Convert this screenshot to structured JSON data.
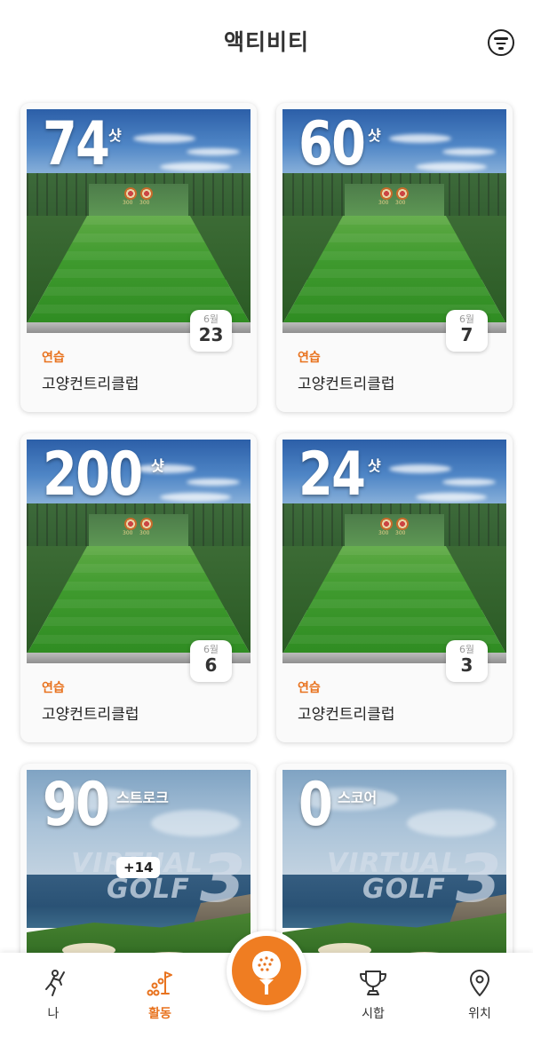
{
  "header": {
    "title": "액티비티"
  },
  "activities": [
    {
      "type": "practice",
      "value": "74",
      "unit": "샷",
      "type_label": "연습",
      "venue": "고양컨트리클럽",
      "month": "6월",
      "day": "23"
    },
    {
      "type": "practice",
      "value": "60",
      "unit": "샷",
      "type_label": "연습",
      "venue": "고양컨트리클럽",
      "month": "6월",
      "day": "7"
    },
    {
      "type": "practice",
      "value": "200",
      "unit": "샷",
      "type_label": "연습",
      "venue": "고양컨트리클럽",
      "month": "6월",
      "day": "6"
    },
    {
      "type": "practice",
      "value": "24",
      "unit": "샷",
      "type_label": "연습",
      "venue": "고양컨트리클럽",
      "month": "6월",
      "day": "3"
    },
    {
      "type": "round",
      "value": "90",
      "unit": "스트로크",
      "diff": "+14",
      "logo_l1": "VIRTUAL",
      "logo_l2": "GOLF",
      "logo_num": "3"
    },
    {
      "type": "round",
      "value": "0",
      "unit": "스코어",
      "logo_l1": "VIRTUAL",
      "logo_l2": "GOLF",
      "logo_num": "3"
    }
  ],
  "nav": {
    "items": [
      {
        "label": "나",
        "icon": "golfer-icon"
      },
      {
        "label": "활동",
        "icon": "activity-flag-icon",
        "active": true
      },
      {
        "label": "시합",
        "icon": "trophy-icon"
      },
      {
        "label": "위치",
        "icon": "location-pin-icon"
      }
    ],
    "center_icon": "golf-ball-tee-icon"
  },
  "colors": {
    "accent": "#e8731f",
    "center_button": "#ef7d22"
  }
}
